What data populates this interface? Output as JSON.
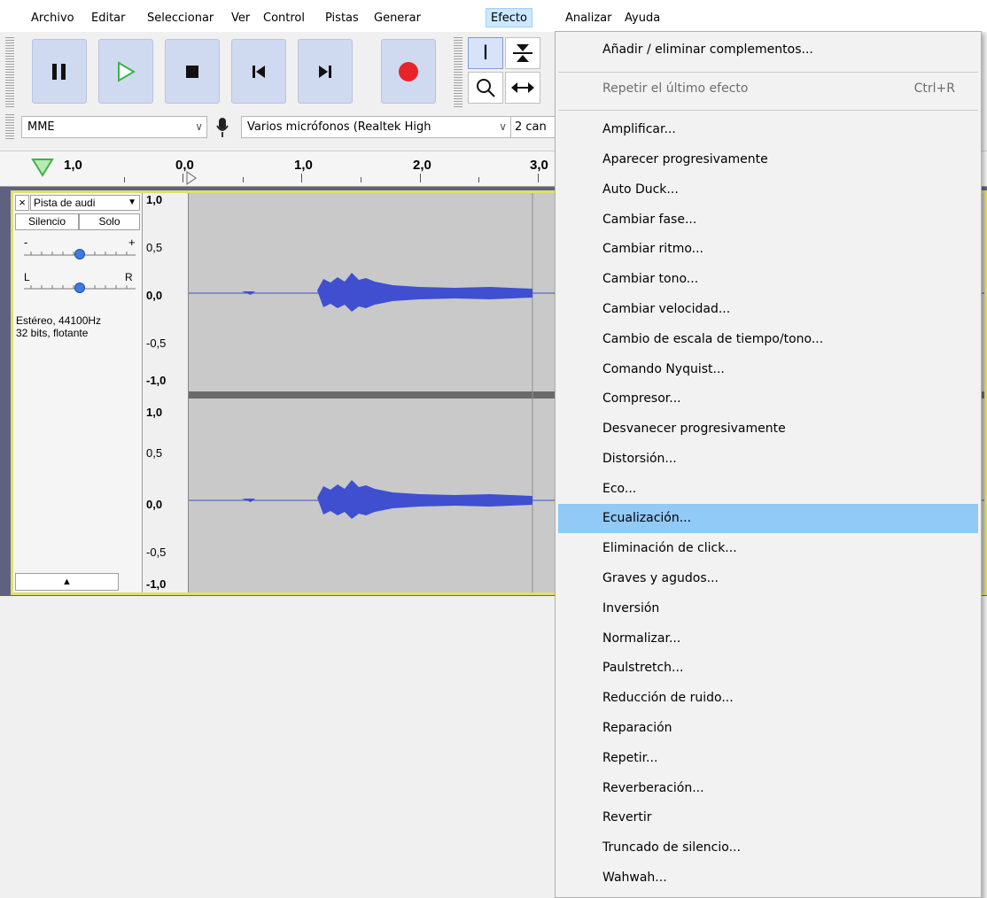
{
  "menubar": {
    "items": [
      "Archivo",
      "Editar",
      "Seleccionar",
      "Ver",
      "Control",
      "Pistas",
      "Generar",
      "Efecto",
      "Analizar",
      "Ayuda"
    ],
    "active": "Efecto"
  },
  "transport": {
    "buttons": [
      {
        "name": "pause",
        "icon": "pause-icon"
      },
      {
        "name": "play",
        "icon": "play-icon"
      },
      {
        "name": "stop",
        "icon": "stop-icon"
      },
      {
        "name": "skip-to-start",
        "icon": "skip-start-icon"
      },
      {
        "name": "skip-to-end",
        "icon": "skip-end-icon"
      },
      {
        "name": "record",
        "icon": "record-icon"
      }
    ],
    "colors": {
      "play": "#3cb34a",
      "record": "#e8242a",
      "button_bg": "#cfdaf0"
    }
  },
  "tools": [
    "selection-tool-icon",
    "envelope-tool-icon",
    "zoom-tool-icon",
    "timeshift-tool-icon"
  ],
  "device": {
    "host": "MME",
    "input_device": "Varios micrófonos (Realtek High",
    "channels": "2 can"
  },
  "ruler": {
    "labels": [
      "1,0",
      "0,0",
      "1,0",
      "2,0",
      "3,0"
    ]
  },
  "track": {
    "name": "Pista de audi",
    "mute_label": "Silencio",
    "solo_label": "Solo",
    "gain_minus": "-",
    "gain_plus": "+",
    "pan_left": "L",
    "pan_right": "R",
    "info_line1": "Estéreo, 44100Hz",
    "info_line2": "32 bits, flotante",
    "scale_labels": [
      "1,0",
      "0,5",
      "0,0",
      "-0,5",
      "-1,0"
    ],
    "wave_color": "#3f4fd0"
  },
  "effect_menu": {
    "items": [
      {
        "label": "Añadir / eliminar complementos...",
        "enabled": true
      },
      {
        "label": "Repetir el último efecto",
        "shortcut": "Ctrl+R",
        "enabled": false
      },
      {
        "label": "Amplificar...",
        "enabled": true
      },
      {
        "label": "Aparecer progresivamente",
        "enabled": true
      },
      {
        "label": "Auto Duck...",
        "enabled": true
      },
      {
        "label": "Cambiar fase...",
        "enabled": true
      },
      {
        "label": "Cambiar ritmo...",
        "enabled": true
      },
      {
        "label": "Cambiar tono...",
        "enabled": true
      },
      {
        "label": "Cambiar velocidad...",
        "enabled": true
      },
      {
        "label": "Cambio de escala de tiempo/tono...",
        "enabled": true
      },
      {
        "label": "Comando Nyquist...",
        "enabled": true
      },
      {
        "label": "Compresor...",
        "enabled": true
      },
      {
        "label": "Desvanecer progresivamente",
        "enabled": true
      },
      {
        "label": "Distorsión...",
        "enabled": true
      },
      {
        "label": "Eco...",
        "enabled": true
      },
      {
        "label": "Ecualización...",
        "enabled": true,
        "highlighted": true
      },
      {
        "label": "Eliminación de click...",
        "enabled": true
      },
      {
        "label": "Graves y agudos...",
        "enabled": true
      },
      {
        "label": "Inversión",
        "enabled": true
      },
      {
        "label": "Normalizar...",
        "enabled": true
      },
      {
        "label": "Paulstretch...",
        "enabled": true
      },
      {
        "label": "Reducción de ruido...",
        "enabled": true
      },
      {
        "label": "Reparación",
        "enabled": true
      },
      {
        "label": "Repetir...",
        "enabled": true
      },
      {
        "label": "Reverberación...",
        "enabled": true
      },
      {
        "label": "Revertir",
        "enabled": true
      },
      {
        "label": "Truncado de silencio...",
        "enabled": true
      },
      {
        "label": "Wahwah...",
        "enabled": true
      }
    ],
    "highlight_color": "#91c9f7"
  }
}
